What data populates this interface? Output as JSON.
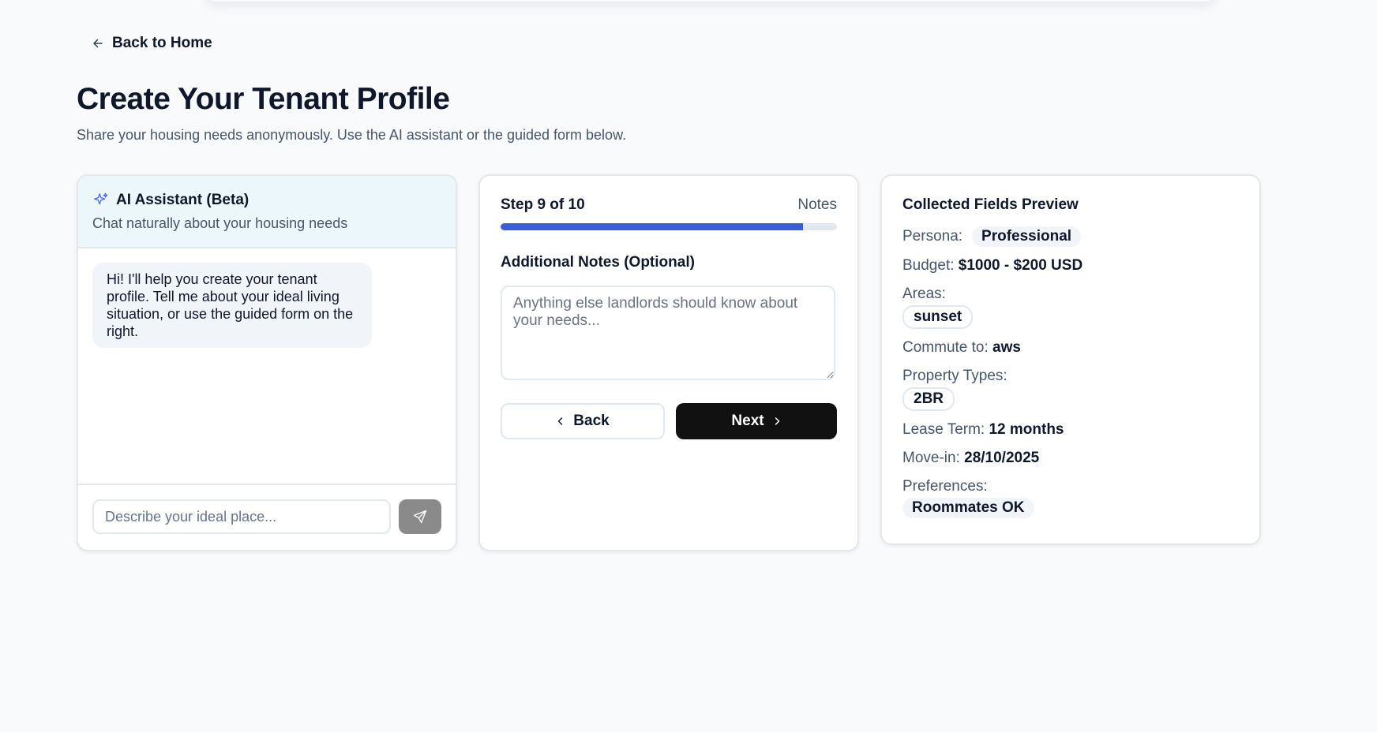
{
  "nav": {
    "back_label": "Back to Home"
  },
  "page": {
    "title": "Create Your Tenant Profile",
    "subtitle": "Share your housing needs anonymously. Use the AI assistant or the guided form below."
  },
  "assistant": {
    "title": "AI Assistant (Beta)",
    "subtitle": "Chat naturally about your housing needs",
    "message": "Hi! I'll help you create your tenant profile. Tell me about your ideal living situation, or use the guided form on the right.",
    "input_placeholder": "Describe your ideal place...",
    "icons": {
      "title": "sparkles-icon",
      "send": "send-icon"
    }
  },
  "form": {
    "step_label": "Step 9 of 10",
    "step_name": "Notes",
    "progress_fraction": 0.9,
    "accent": "#3b5bdb",
    "field_label": "Additional Notes (Optional)",
    "notes_placeholder": "Anything else landlords should know about your needs...",
    "notes_value": "",
    "back_label": "Back",
    "next_label": "Next"
  },
  "preview": {
    "title": "Collected Fields Preview",
    "persona_label": "Persona:",
    "persona_value": "Professional",
    "budget_label": "Budget:",
    "budget_value": "$1000 - $200 USD",
    "areas_label": "Areas:",
    "areas": [
      "sunset"
    ],
    "commute_label": "Commute to:",
    "commute_value": "aws",
    "property_types_label": "Property Types:",
    "property_types": [
      "2BR"
    ],
    "lease_label": "Lease Term:",
    "lease_value": "12 months",
    "movein_label": "Move-in:",
    "movein_value": "28/10/2025",
    "preferences_label": "Preferences:",
    "preferences": [
      "Roommates OK"
    ]
  }
}
